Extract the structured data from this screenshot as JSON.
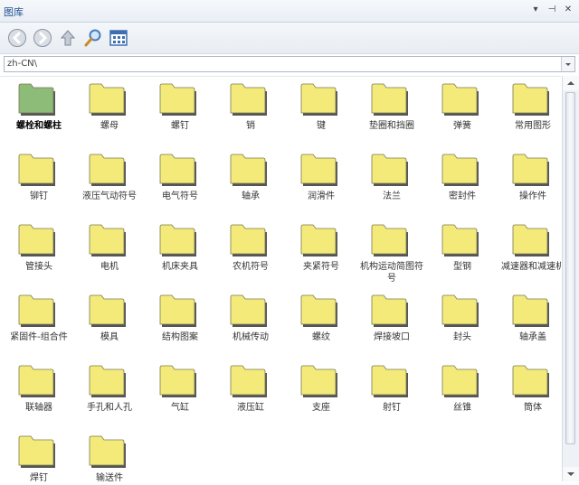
{
  "window": {
    "title": "图库",
    "controls": [
      "▾",
      "⊣",
      "✕"
    ]
  },
  "toolbar": {
    "buttons": [
      "back-icon",
      "forward-icon",
      "up-icon",
      "search-icon",
      "view-icon"
    ]
  },
  "pathbar": {
    "value": "zh-CN\\"
  },
  "colors": {
    "folder": "#f4ea7a",
    "folder_selected": "#8dbb78",
    "folder_edge": "#555555",
    "accent": "#1f4f8f"
  },
  "folders": [
    {
      "label": "螺栓和螺柱",
      "selected": true
    },
    {
      "label": "螺母"
    },
    {
      "label": "螺钉"
    },
    {
      "label": "销"
    },
    {
      "label": "键"
    },
    {
      "label": "垫圈和挡圈"
    },
    {
      "label": "弹簧"
    },
    {
      "label": "常用图形"
    },
    {
      "label": "铆钉"
    },
    {
      "label": "液压气动符号"
    },
    {
      "label": "电气符号"
    },
    {
      "label": "轴承"
    },
    {
      "label": "润滑件"
    },
    {
      "label": "法兰"
    },
    {
      "label": "密封件"
    },
    {
      "label": "操作件"
    },
    {
      "label": "管接头"
    },
    {
      "label": "电机"
    },
    {
      "label": "机床夹具"
    },
    {
      "label": "农机符号"
    },
    {
      "label": "夹紧符号"
    },
    {
      "label": "机构运动简图符号"
    },
    {
      "label": "型钢"
    },
    {
      "label": "减速器和减速机"
    },
    {
      "label": "紧固件-组合件"
    },
    {
      "label": "模具"
    },
    {
      "label": "结构图案"
    },
    {
      "label": "机械传动"
    },
    {
      "label": "螺纹"
    },
    {
      "label": "焊接坡口"
    },
    {
      "label": "封头"
    },
    {
      "label": "轴承盖"
    },
    {
      "label": "联轴器"
    },
    {
      "label": "手孔和人孔"
    },
    {
      "label": "气缸"
    },
    {
      "label": "液压缸"
    },
    {
      "label": "支座"
    },
    {
      "label": "射钉"
    },
    {
      "label": "丝锥"
    },
    {
      "label": "筒体"
    },
    {
      "label": "焊钉"
    },
    {
      "label": "输送件"
    }
  ]
}
